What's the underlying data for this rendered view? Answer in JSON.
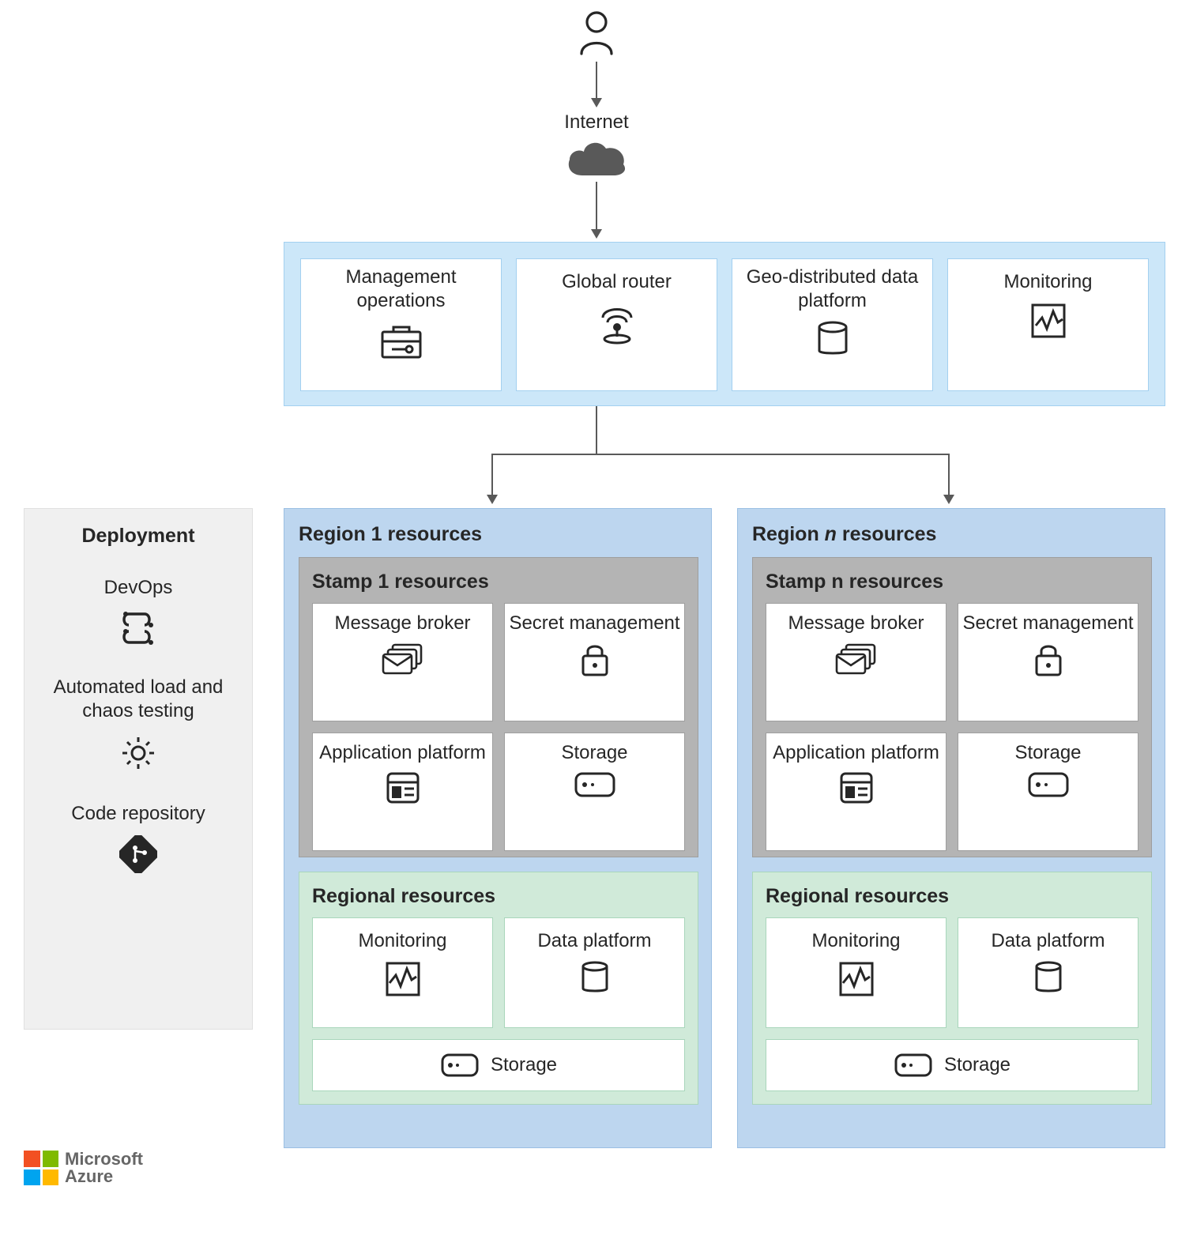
{
  "top": {
    "internet_label": "Internet"
  },
  "global": {
    "management": "Management operations",
    "router": "Global router",
    "data_platform": "Geo-distributed data platform",
    "monitoring": "Monitoring"
  },
  "deployment": {
    "title": "Deployment",
    "devops": "DevOps",
    "testing": "Automated load and chaos testing",
    "repo": "Code repository"
  },
  "regions": [
    {
      "title": "Region 1 resources",
      "stamp_title": "Stamp 1 resources",
      "regional_title": "Regional resources",
      "stamp": {
        "broker": "Message broker",
        "secret": "Secret management",
        "app": "Application platform",
        "storage": "Storage"
      },
      "regional": {
        "monitoring": "Monitoring",
        "data": "Data platform",
        "storage": "Storage"
      }
    },
    {
      "title_prefix": "Region ",
      "title_n": "n",
      "title_suffix": " resources",
      "stamp_title": "Stamp n resources",
      "regional_title": "Regional resources",
      "stamp": {
        "broker": "Message broker",
        "secret": "Secret management",
        "app": "Application platform",
        "storage": "Storage"
      },
      "regional": {
        "monitoring": "Monitoring",
        "data": "Data platform",
        "storage": "Storage"
      }
    }
  ],
  "footer": {
    "brand1": "Microsoft",
    "brand2": "Azure"
  }
}
